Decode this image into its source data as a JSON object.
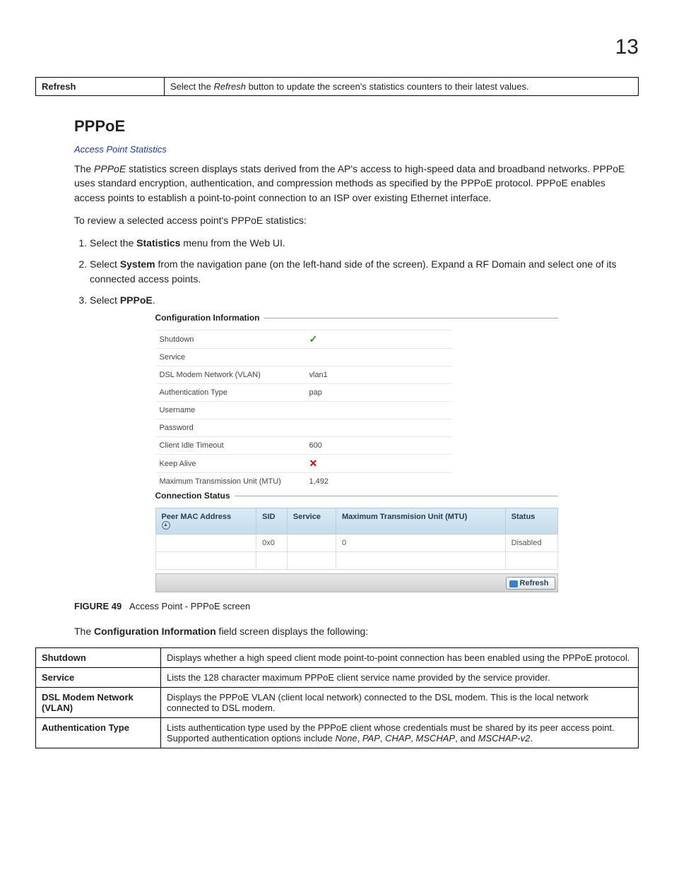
{
  "chapter_number": "13",
  "refresh_row": {
    "label": "Refresh",
    "desc_prefix": "Select the ",
    "desc_em": "Refresh",
    "desc_suffix": " button to update the screen's statistics counters to their latest values."
  },
  "section_title": "PPPoE",
  "breadcrumb": "Access Point Statistics",
  "intro": {
    "p1_pre": "The ",
    "p1_em": "PPPoE",
    "p1_post": " statistics screen displays stats derived from the AP's access to high-speed data and broadband networks. PPPoE uses standard encryption, authentication, and compression methods as specified by the PPPoE protocol. PPPoE enables access points to establish a point-to-point connection to an ISP over existing Ethernet interface.",
    "p2": "To review a selected access point's PPPoE statistics:"
  },
  "steps": {
    "s1_pre": "Select the ",
    "s1_b": "Statistics",
    "s1_post": " menu from the Web UI.",
    "s2_pre": "Select ",
    "s2_b": "System",
    "s2_post": " from the navigation pane (on the left-hand side of the screen). Expand a RF Domain and select one of its connected access points.",
    "s3_pre": "Select ",
    "s3_b": "PPPoE",
    "s3_post": "."
  },
  "figure": {
    "cfg_legend": "Configuration Information",
    "rows": {
      "shutdown": "Shutdown",
      "service": "Service",
      "dsl": "DSL Modem Network (VLAN)",
      "dsl_v": "vlan1",
      "auth": "Authentication Type",
      "auth_v": "pap",
      "user": "Username",
      "pass": "Password",
      "idle": "Client Idle Timeout",
      "idle_v": "600",
      "keep": "Keep Alive",
      "mtu": "Maximum Transmission Unit (MTU)",
      "mtu_v": "1,492"
    },
    "cs_legend": "Connection Status",
    "cs_headers": {
      "peer": "Peer MAC Address",
      "sid": "SID",
      "svc": "Service",
      "mtu": "Maximum Transmision Unit (MTU)",
      "status": "Status"
    },
    "cs_row": {
      "sid": "0x0",
      "mtu": "0",
      "status": "Disabled"
    },
    "refresh_btn": "Refresh"
  },
  "caption": {
    "label": "FIGURE 49",
    "text": "Access Point - PPPoE screen"
  },
  "post_figure": {
    "pre": "The ",
    "b": "Configuration Information",
    "post": " field screen displays the following:"
  },
  "desc_table": {
    "shutdown": {
      "label": "Shutdown",
      "text": "Displays whether a high speed client mode point-to-point connection has been enabled using the PPPoE protocol."
    },
    "service": {
      "label": "Service",
      "text": "Lists the 128 character maximum PPPoE client service name provided by the service provider."
    },
    "dsl": {
      "label": "DSL Modem Network (VLAN)",
      "text": "Displays the PPPoE VLAN (client local network) connected to the DSL modem. This is the local network connected to DSL modem."
    },
    "auth": {
      "label": "Authentication Type",
      "t1": "Lists authentication type used by the PPPoE client whose credentials must be shared by its peer access point. Supported authentication options include ",
      "i1": "None",
      "c1": ", ",
      "i2": "PAP",
      "c2": ", ",
      "i3": "CHAP",
      "c3": ", ",
      "i4": "MSCHAP",
      "c4": ", and ",
      "i5": "MSCHAP-v2",
      "c5": "."
    }
  }
}
